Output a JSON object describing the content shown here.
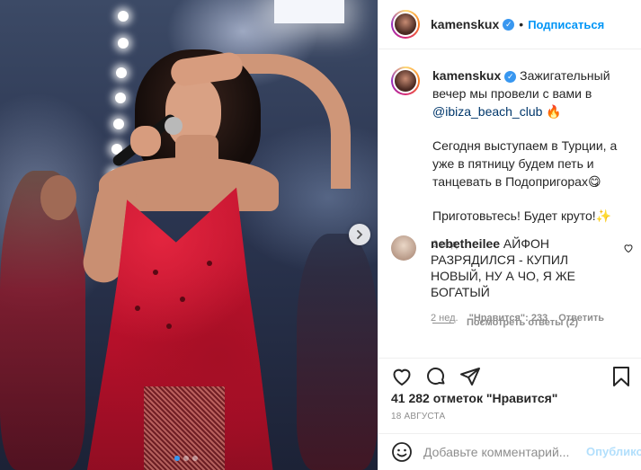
{
  "header": {
    "username": "kamenskux",
    "separator": "•",
    "follow_label": "Подписаться"
  },
  "caption": {
    "username": "kamenskux",
    "line1": "Зажигательный вечер мы провели с вами в",
    "mention": "@ibiza_beach_club",
    "emoji1": "🔥",
    "paragraph2": "Сегодня выступаем в Турции, а уже в пятницу будем петь и танцевать в Подопригорах",
    "emoji2": "😋",
    "paragraph3": "Приготовьтесь! Будет круто!",
    "emoji3": "✨",
    "time": "2 нед."
  },
  "comment": {
    "username": "nebetheilee",
    "text": "АЙФОН РАЗРЯДИЛСЯ - КУПИЛ НОВЫЙ, НУ А ЧО, Я ЖЕ БОГАТЫЙ",
    "time": "2 нед.",
    "likes": "\"Нравится\": 233",
    "reply_label": "Ответить",
    "view_replies": "Посмотреть ответы (2)"
  },
  "post": {
    "likes_text": "41 282 отметок \"Нравится\"",
    "date": "18 АВГУСТА"
  },
  "add_comment": {
    "placeholder": "Добавьте комментарий...",
    "publish_label": "Опубликовать"
  },
  "icons": {
    "like": "heart-icon",
    "comment": "comment-icon",
    "share": "share-icon",
    "save": "bookmark-icon",
    "emoji": "smile-icon",
    "next": "chevron-right-icon",
    "verified": "verified-icon"
  },
  "colors": {
    "link_blue": "#0095f6",
    "publish_disabled": "#b2dffc",
    "mention": "#00376b",
    "meta_gray": "#8e8e8e"
  },
  "carousel": {
    "total": 3,
    "active": 1
  }
}
